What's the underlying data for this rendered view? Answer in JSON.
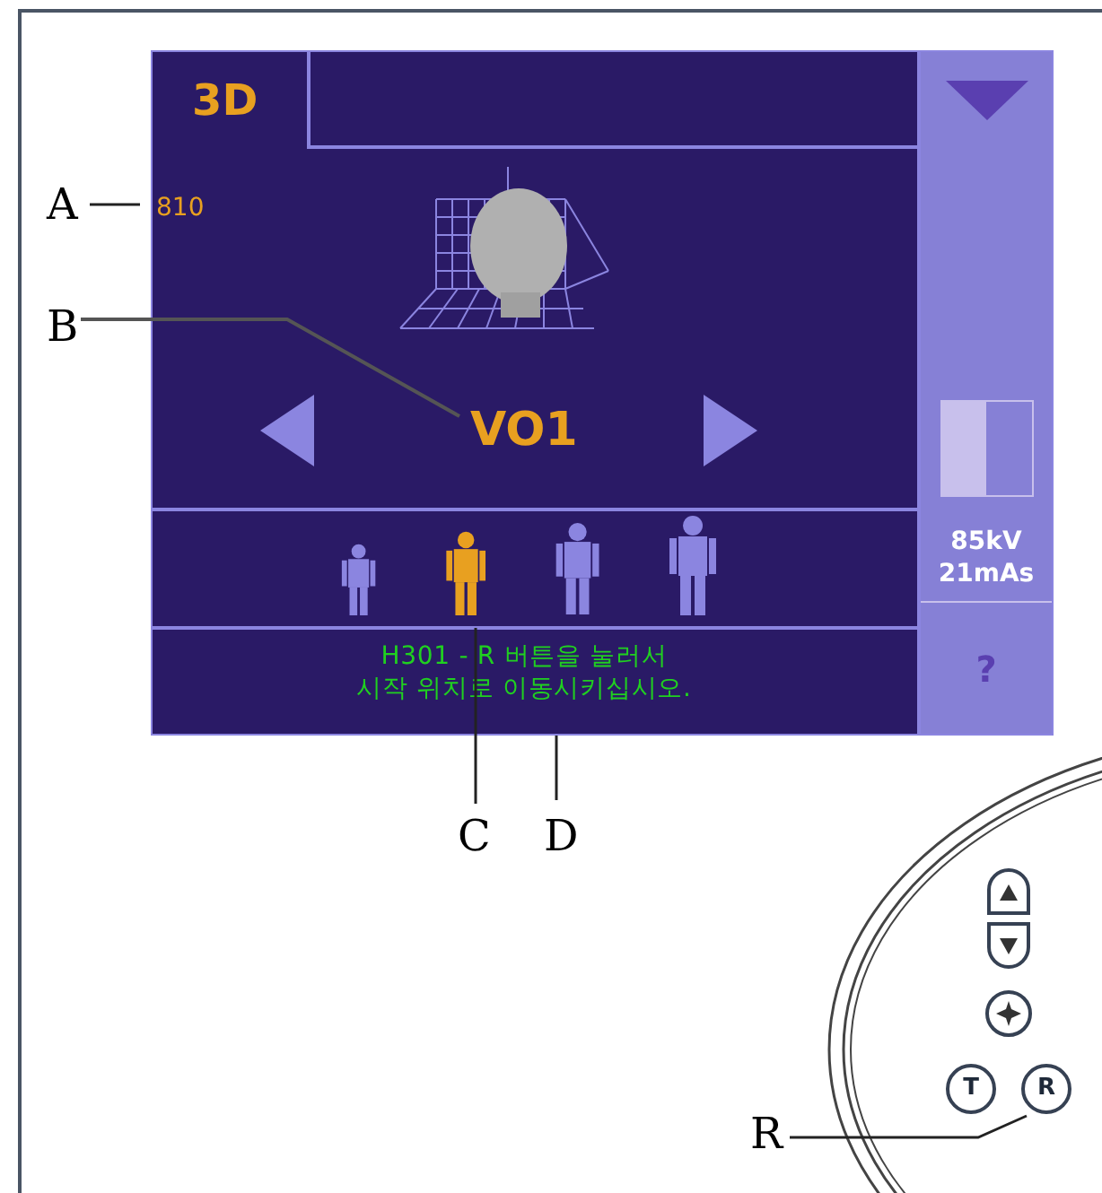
{
  "screen": {
    "tab": {
      "label": "3D",
      "selected": true
    },
    "program_code": "810",
    "view_label": "VO1",
    "patient_sizes": [
      {
        "selected": false
      },
      {
        "selected": true
      },
      {
        "selected": false
      },
      {
        "selected": false
      }
    ],
    "message_lines": [
      "H301 - R 버튼을 눌러서",
      "시작 위치로 이동시키십시오."
    ],
    "sidebar": {
      "readings": [
        "85kV",
        "21mAs"
      ],
      "help": "?"
    }
  },
  "control_panel": {
    "buttons": [
      {
        "kind": "up"
      },
      {
        "kind": "down"
      },
      {
        "kind": "star"
      },
      {
        "kind": "letter",
        "label": "T"
      },
      {
        "kind": "letter",
        "label": "R"
      }
    ]
  },
  "callouts": [
    "A",
    "B",
    "C",
    "D",
    "R"
  ]
}
